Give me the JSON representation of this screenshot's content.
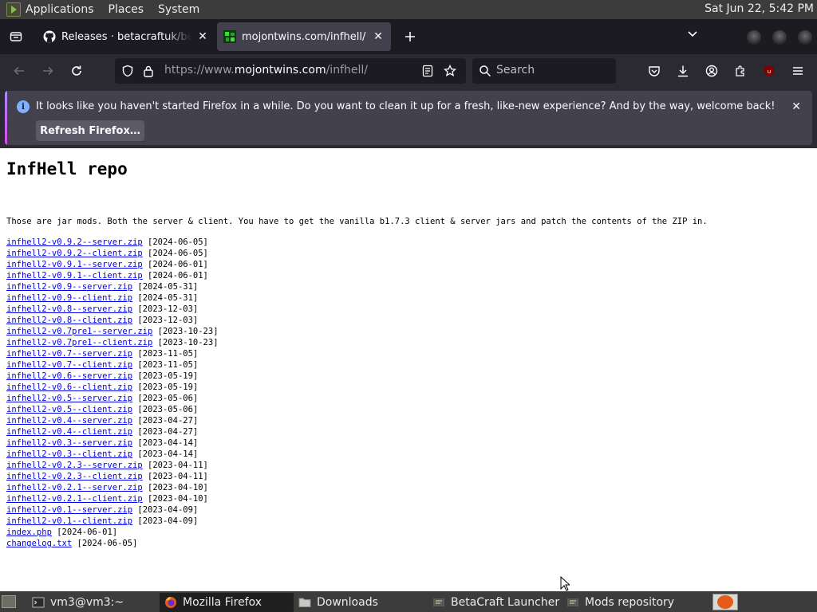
{
  "top_panel": {
    "menus": [
      "Applications",
      "Places",
      "System"
    ],
    "clock": "Sat Jun 22,  5:42 PM"
  },
  "browser": {
    "tabs": [
      {
        "title": "Releases · betacraftuk/betacraft",
        "active": false,
        "icon": "github-icon"
      },
      {
        "title": "mojontwins.com/infhell/",
        "active": true,
        "icon": "site-favicon"
      }
    ],
    "url": {
      "prefix": "https://www.",
      "host": "mojontwins.com",
      "path": "/infhell/"
    },
    "search_placeholder": "Search",
    "notification": {
      "message": "It looks like you haven't started Firefox in a while. Do you want to clean it up for a fresh, like-new experience? And by the way, welcome back!",
      "button": "Refresh Firefox…"
    }
  },
  "page": {
    "title": "InfHell repo",
    "description": "Those are jar mods. Both the server & client. You have to get the vanilla b1.7.3 client & server jars and patch the contents of the ZIP in.",
    "files": [
      {
        "name": "infhell2-v0.9.2--server.zip",
        "date": "[2024-06-05]"
      },
      {
        "name": "infhell2-v0.9.2--client.zip",
        "date": "[2024-06-05]"
      },
      {
        "name": "infhell2-v0.9.1--server.zip",
        "date": "[2024-06-01]"
      },
      {
        "name": "infhell2-v0.9.1--client.zip",
        "date": "[2024-06-01]"
      },
      {
        "name": "infhell2-v0.9--server.zip",
        "date": "[2024-05-31]"
      },
      {
        "name": "infhell2-v0.9--client.zip",
        "date": "[2024-05-31]"
      },
      {
        "name": "infhell2-v0.8--server.zip",
        "date": "[2023-12-03]"
      },
      {
        "name": "infhell2-v0.8--client.zip",
        "date": "[2023-12-03]"
      },
      {
        "name": "infhell2-v0.7pre1--server.zip",
        "date": "[2023-10-23]"
      },
      {
        "name": "infhell2-v0.7pre1--client.zip",
        "date": "[2023-10-23]"
      },
      {
        "name": "infhell2-v0.7--server.zip",
        "date": "[2023-11-05]"
      },
      {
        "name": "infhell2-v0.7--client.zip",
        "date": "[2023-11-05]"
      },
      {
        "name": "infhell2-v0.6--server.zip",
        "date": "[2023-05-19]"
      },
      {
        "name": "infhell2-v0.6--client.zip",
        "date": "[2023-05-19]"
      },
      {
        "name": "infhell2-v0.5--server.zip",
        "date": "[2023-05-06]"
      },
      {
        "name": "infhell2-v0.5--client.zip",
        "date": "[2023-05-06]"
      },
      {
        "name": "infhell2-v0.4--server.zip",
        "date": "[2023-04-27]"
      },
      {
        "name": "infhell2-v0.4--client.zip",
        "date": "[2023-04-27]"
      },
      {
        "name": "infhell2-v0.3--server.zip",
        "date": "[2023-04-14]"
      },
      {
        "name": "infhell2-v0.3--client.zip",
        "date": "[2023-04-14]"
      },
      {
        "name": "infhell2-v0.2.3--server.zip",
        "date": "[2023-04-11]"
      },
      {
        "name": "infhell2-v0.2.3--client.zip",
        "date": "[2023-04-11]"
      },
      {
        "name": "infhell2-v0.2.1--server.zip",
        "date": "[2023-04-10]"
      },
      {
        "name": "infhell2-v0.2.1--client.zip",
        "date": "[2023-04-10]"
      },
      {
        "name": "infhell2-v0.1--server.zip",
        "date": "[2023-04-09]"
      },
      {
        "name": "infhell2-v0.1--client.zip",
        "date": "[2023-04-09]"
      },
      {
        "name": "index.php",
        "date": "[2024-06-01]"
      },
      {
        "name": "changelog.txt",
        "date": "[2024-06-05]"
      }
    ]
  },
  "taskbar": {
    "tasks": [
      {
        "label": "vm3@vm3:~",
        "icon": "terminal-icon",
        "active": false
      },
      {
        "label": "Mozilla Firefox",
        "icon": "firefox-icon",
        "active": true
      },
      {
        "label": "Downloads",
        "icon": "folder-icon",
        "active": false
      },
      {
        "label": "BetaCraft Launcher ...",
        "icon": "java-app-icon",
        "active": false
      },
      {
        "label": "Mods repository",
        "icon": "java-app-icon",
        "active": false
      }
    ]
  },
  "colors": {
    "link": "#0000ee",
    "panel": "#3c3c3c",
    "firefox_chrome": "#2b2a33",
    "tab_active": "#42414d",
    "notification_accent": "#a78bfa"
  }
}
